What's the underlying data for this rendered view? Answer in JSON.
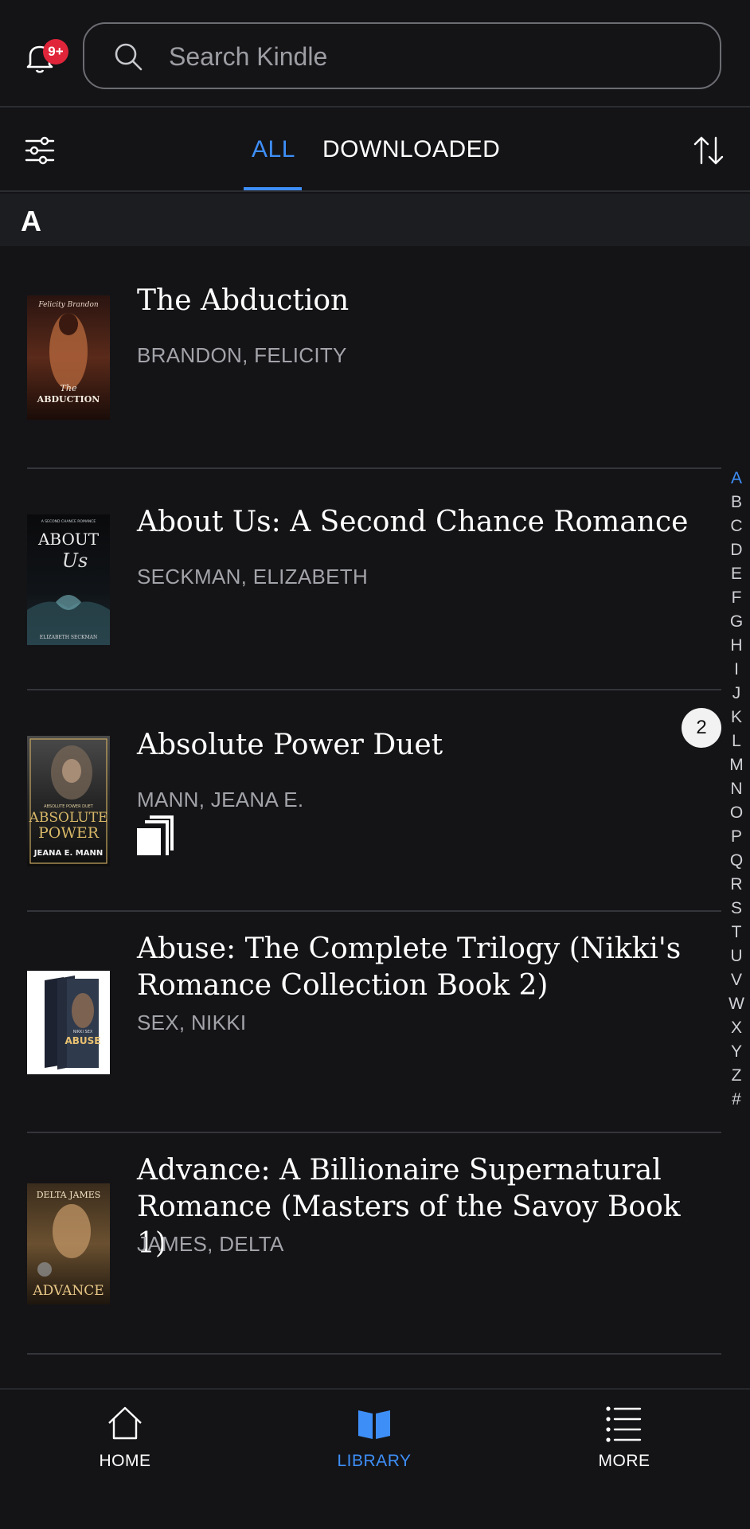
{
  "header": {
    "notification_badge": "9+",
    "search_placeholder": "Search Kindle"
  },
  "filter_bar": {
    "tabs": [
      {
        "label": "ALL",
        "selected": true
      },
      {
        "label": "DOWNLOADED",
        "selected": false
      }
    ]
  },
  "section_header": "A",
  "books": [
    {
      "title": "The Abduction",
      "author": "BRANDON, FELICITY",
      "cover_text": [
        "Felicity Brandon",
        "The",
        "ABDUCTION"
      ]
    },
    {
      "title": "About Us: A Second Chance Romance",
      "author": "SECKMAN, ELIZABETH",
      "cover_text": [
        "A SECOND CHANCE ROMANCE",
        "ABOUT",
        "Us",
        "ELIZABETH SECKMAN"
      ]
    },
    {
      "title": "Absolute Power Duet",
      "author": "MANN, JEANA E.",
      "is_series": true,
      "cover_text": [
        "ABSOLUTE POWER DUET",
        "ABSOLUTE",
        "POWER",
        "JEANA E. MANN"
      ]
    },
    {
      "title": "Abuse: The Complete Trilogy (Nikki's Romance Collection Book 2)",
      "author": "SEX, NIKKI",
      "cover_text": [
        "ABUSE",
        "NIKKI SEX"
      ]
    },
    {
      "title": "Advance: A Billionaire Supernatural Romance (Masters of the Savoy Book 1)",
      "author": "JAMES, DELTA",
      "cover_text": [
        "DELTA JAMES",
        "ADVANCE"
      ]
    }
  ],
  "alphabet_index": {
    "letters": [
      "A",
      "B",
      "C",
      "D",
      "E",
      "F",
      "G",
      "H",
      "I",
      "J",
      "K",
      "L",
      "M",
      "N",
      "O",
      "P",
      "Q",
      "R",
      "S",
      "T",
      "U",
      "V",
      "W",
      "X",
      "Y",
      "Z",
      "#"
    ],
    "active": "A",
    "count_bubble": "2"
  },
  "bottom_nav": [
    {
      "label": "HOME",
      "icon": "home-icon",
      "selected": false
    },
    {
      "label": "LIBRARY",
      "icon": "book-icon",
      "selected": true
    },
    {
      "label": "MORE",
      "icon": "list-icon",
      "selected": false
    }
  ],
  "colors": {
    "background": "#141417",
    "accent": "#3e8ef7",
    "badge": "#e0253a",
    "secondary_text": "#a3a4a9"
  }
}
